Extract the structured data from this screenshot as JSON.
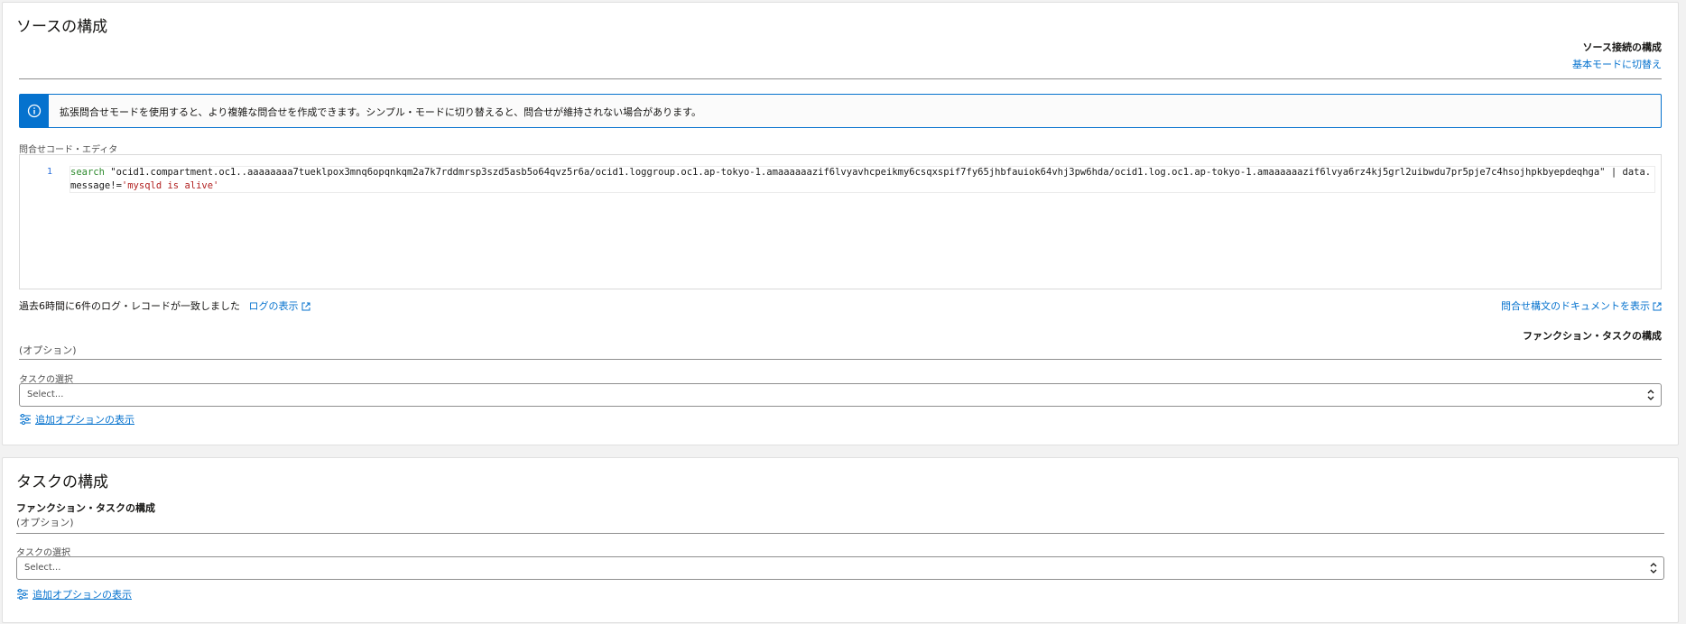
{
  "source": {
    "title": "ソースの構成",
    "connection_header": "ソース接続の構成",
    "switch_basic_mode": "基本モードに切替え",
    "info_message": "拡張問合せモードを使用すると、より複雑な問合せを作成できます。シンプル・モードに切り替えると、問合せが維持されない場合があります。",
    "editor_label": "問合せコード・エディタ",
    "editor": {
      "line_number": "1",
      "keyword": "search",
      "target": "\"ocid1.compartment.oc1..aaaaaaaa7tueklpox3mnq6opqnkqm2a7k7rddmrsp3szd5asb5o64qvz5r6a/ocid1.loggroup.oc1.ap-tokyo-1.amaaaaaazif6lvyavhcpeikmy6csqxspif7fy65jhbfauiok64vhj3pw6hda/ocid1.log.oc1.ap-tokyo-1.amaaaaaazif6lvya6rz4kj5grl2uibwdu7pr5pje7c4hsojhpkbyepdeqhga\"",
      "pipe": "|",
      "filter_field": "data.message!=",
      "filter_value": "'mysqld is alive'"
    },
    "match_status": "過去6時間に6件のログ・レコードが一致しました",
    "view_logs": "ログの表示",
    "query_syntax_docs": "問合せ構文のドキュメントを表示",
    "function_task_header": "ファンクション・タスクの構成",
    "optional": "(オプション)",
    "task_select_label": "タスクの選択",
    "task_select_placeholder": "Select...",
    "show_more_options": "追加オプションの表示"
  },
  "task": {
    "title": "タスクの構成",
    "function_task_header": "ファンクション・タスクの構成",
    "optional": "(オプション)",
    "task_select_label": "タスクの選択",
    "task_select_placeholder": "Select...",
    "show_more_options": "追加オプションの表示"
  },
  "colors": {
    "accent": "#0572ce",
    "keyword": "#2e8b2e",
    "literal": "#b22222"
  }
}
